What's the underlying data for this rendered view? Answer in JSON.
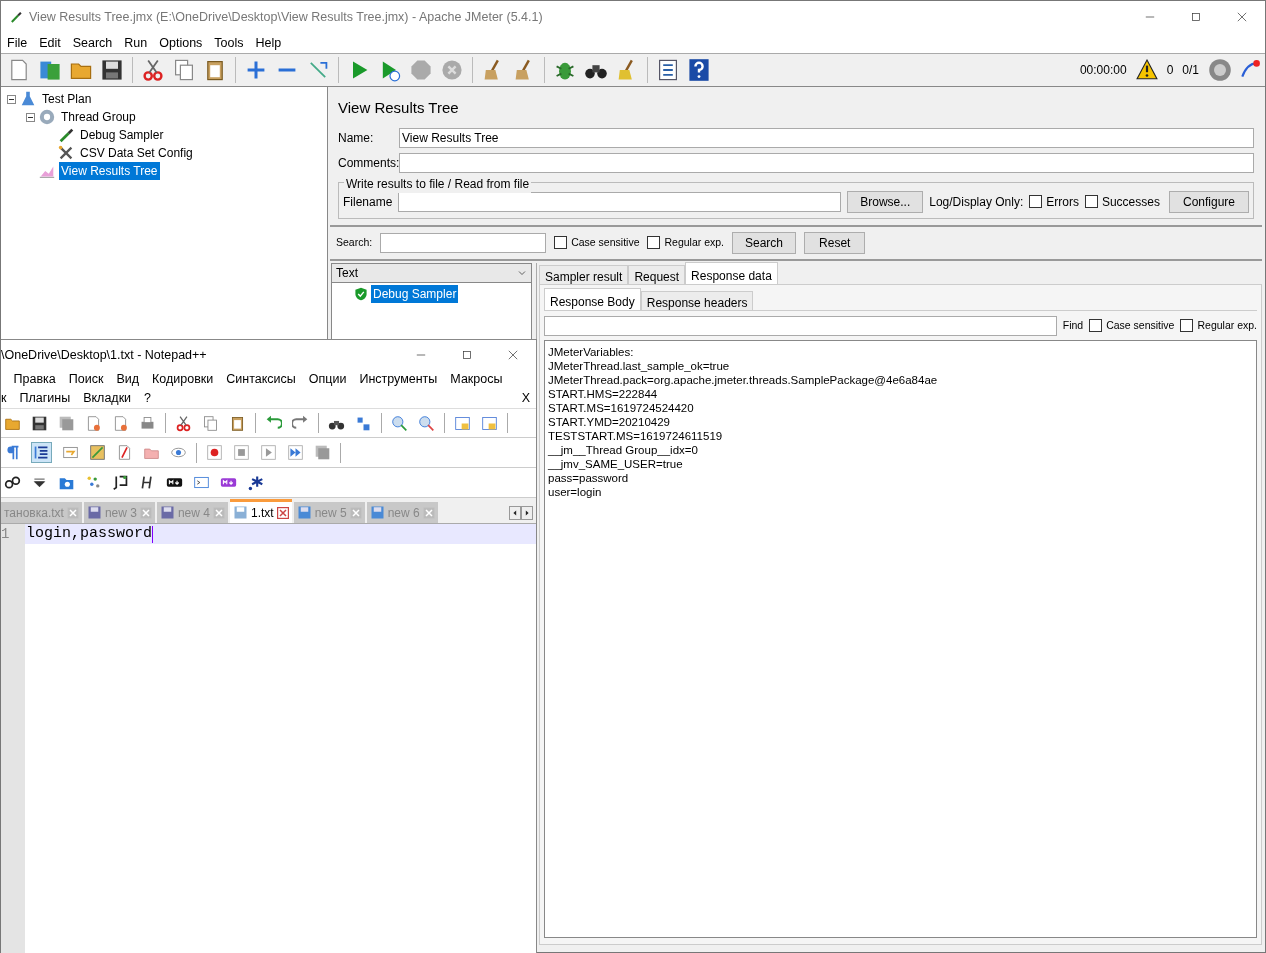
{
  "jmeter": {
    "window": {
      "title": "View Results Tree.jmx (E:\\OneDrive\\Desktop\\View Results Tree.jmx) - Apache JMeter (5.4.1)"
    },
    "menu": [
      "File",
      "Edit",
      "Search",
      "Run",
      "Options",
      "Tools",
      "Help"
    ],
    "status": {
      "timer": "00:00:00",
      "warnings": "0",
      "threads": "0/1"
    },
    "tree": [
      {
        "label": "Test Plan",
        "kind": "plan",
        "selected": false,
        "expanded": true,
        "children": [
          {
            "label": "Thread Group",
            "kind": "thread-group",
            "selected": false,
            "expanded": true,
            "children": [
              {
                "label": "Debug Sampler",
                "kind": "sampler",
                "selected": false
              },
              {
                "label": "CSV Data Set Config",
                "kind": "config",
                "selected": false
              }
            ]
          },
          {
            "label": "View Results Tree",
            "kind": "listener",
            "selected": true
          }
        ]
      }
    ],
    "panel": {
      "title": "View Results Tree",
      "name_label": "Name:",
      "name_value": "View Results Tree",
      "comments_label": "Comments:",
      "file_group": {
        "legend": "Write results to file / Read from file",
        "filename_label": "Filename",
        "browse_button": "Browse...",
        "log_label": "Log/Display Only:",
        "options": [
          {
            "label": "Errors",
            "checked": false
          },
          {
            "label": "Successes",
            "checked": false
          }
        ],
        "configure_button": "Configure"
      },
      "search": {
        "label": "Search:",
        "options": [
          {
            "label": "Case sensitive",
            "checked": false
          },
          {
            "label": "Regular exp.",
            "checked": false
          }
        ],
        "search_button": "Search",
        "reset_button": "Reset"
      },
      "renderer": "Text",
      "results": [
        {
          "label": "Debug Sampler",
          "selected": true,
          "ok": true
        }
      ],
      "tabs": [
        {
          "label": "Sampler result",
          "selected": false
        },
        {
          "label": "Request",
          "selected": false
        },
        {
          "label": "Response data",
          "selected": true
        }
      ],
      "subtabs": [
        {
          "label": "Response Body",
          "selected": true
        },
        {
          "label": "Response headers",
          "selected": false
        }
      ],
      "find": {
        "label": "Find",
        "options": [
          {
            "label": "Case sensitive",
            "checked": false
          },
          {
            "label": "Regular exp.",
            "checked": false
          }
        ]
      },
      "response_lines": [
        "JMeterVariables:",
        "JMeterThread.last_sample_ok=true",
        "JMeterThread.pack=org.apache.jmeter.threads.SamplePackage@4e6a84ae",
        "START.HMS=222844",
        "START.MS=1619724524420",
        "START.YMD=20210429",
        "TESTSTART.MS=1619724611519",
        "__jm__Thread Group__idx=0",
        "__jmv_SAME_USER=true",
        "pass=password",
        "user=login"
      ]
    }
  },
  "notepad": {
    "window": {
      "title": "\\OneDrive\\Desktop\\1.txt - Notepad++"
    },
    "menu_rows": [
      [
        "Правка",
        "Поиск",
        "Вид",
        "Кодировки",
        "Синтаксисы",
        "Опции",
        "Инструменты",
        "Макросы"
      ],
      [
        "к",
        "Плагины",
        "Вкладки",
        "?"
      ]
    ],
    "close_document": "X",
    "indent_guide_on": true,
    "tabs": [
      {
        "label": "тановка.txt",
        "kind": "partial",
        "selected": false
      },
      {
        "label": "new 3",
        "kind": "unsaved",
        "selected": false
      },
      {
        "label": "new 4",
        "kind": "unsaved",
        "selected": false
      },
      {
        "label": "1.txt",
        "kind": "saved",
        "selected": true
      },
      {
        "label": "new 5",
        "kind": "file",
        "selected": false
      },
      {
        "label": "new 6",
        "kind": "file",
        "selected": false
      }
    ],
    "lines": [
      {
        "number": "1",
        "text": "login,password"
      }
    ]
  }
}
